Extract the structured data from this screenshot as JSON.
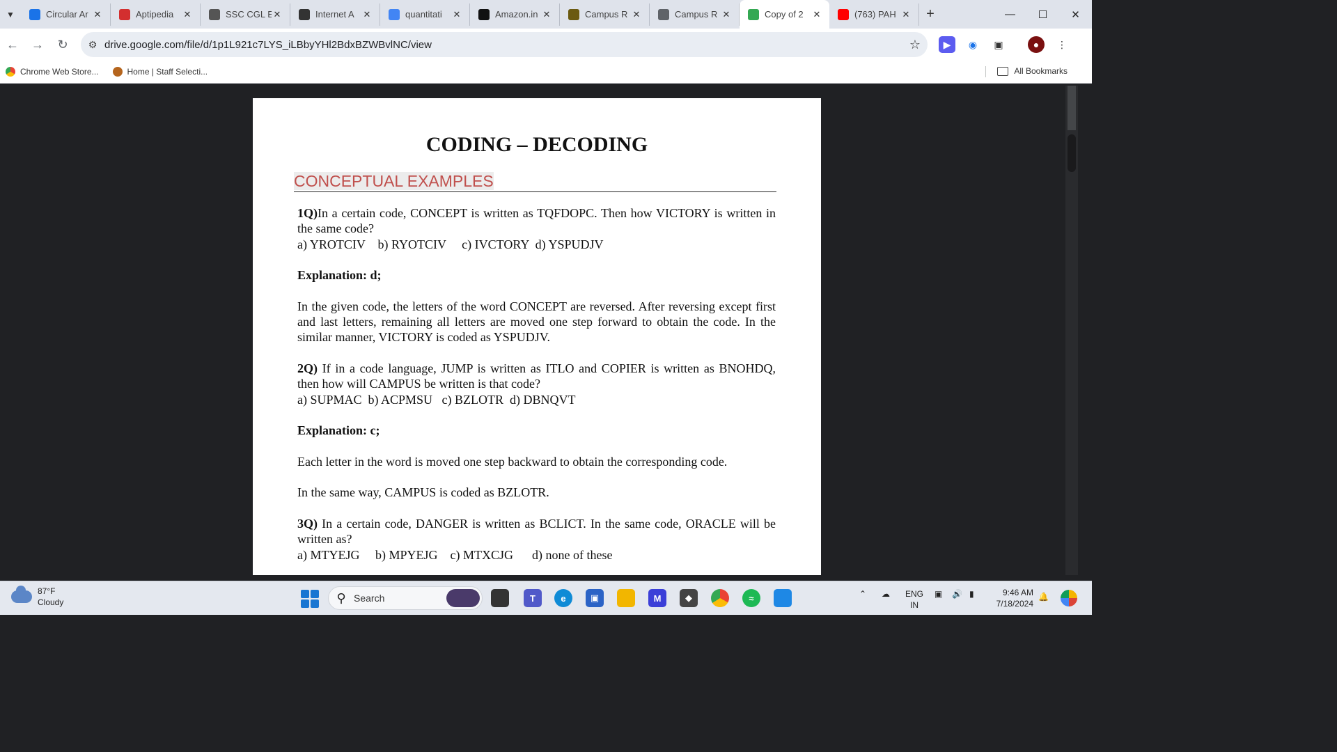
{
  "tabs": [
    {
      "label": "Circular Ar",
      "icon": "bookmark-icon",
      "color": "#1a73e8"
    },
    {
      "label": "Aptipedia",
      "icon": "aptipedia-logo-icon",
      "color": "#d32f2f"
    },
    {
      "label": "SSC CGL E",
      "icon": "chatgpt-icon",
      "color": "#555555"
    },
    {
      "label": "Internet A",
      "icon": "archive-icon",
      "color": "#333333"
    },
    {
      "label": "quantitati",
      "icon": "google-icon",
      "color": "#4285f4"
    },
    {
      "label": "Amazon.in",
      "icon": "amazon-icon",
      "color": "#111111"
    },
    {
      "label": "Campus R",
      "icon": "campus-icon",
      "color": "#6b5a10"
    },
    {
      "label": "Campus R",
      "icon": "globe-icon",
      "color": "#5f6368"
    },
    {
      "label": "Copy of 2",
      "icon": "google-drive-icon",
      "color": "#34a853",
      "active": true
    },
    {
      "label": "(763) PAH",
      "icon": "youtube-icon",
      "color": "#ff0000"
    }
  ],
  "toolbar": {
    "url": "drive.google.com/file/d/1p1L921c7LYS_iLBbyYHl2BdxBZWBvlNC/view"
  },
  "bookmarks": {
    "items": [
      {
        "label": "Chrome Web Store...",
        "icon": "chrome-web-store-icon"
      },
      {
        "label": "Home | Staff Selecti...",
        "icon": "ssc-emblem-icon"
      }
    ],
    "all_label": "All Bookmarks"
  },
  "document": {
    "title": "CODING – DECODING",
    "section": "CONCEPTUAL EXAMPLES",
    "q1": {
      "num": "1Q)",
      "text": "In a certain code, CONCEPT is written as TQFDOPC. Then how VICTORY is written in the same code?",
      "options": "a) YROTCIV    b) RYOTCIV     c) IVCTORY  d) YSPUDJV",
      "expl_label": "Explanation: d;",
      "expl": "In the given code, the letters of the word CONCEPT are reversed. After reversing except first and last letters, remaining all letters are moved one step forward to obtain the code. In the similar manner, VICTORY is coded as YSPUDJV."
    },
    "q2": {
      "num": "2Q)",
      "text": " If in a code language, JUMP is written as ITLO and COPIER is written as BNOHDQ, then how will CAMPUS be written is that code?",
      "options": "a) SUPMAC  b) ACPMSU   c) BZLOTR  d) DBNQVT",
      "expl_label": "Explanation: c;",
      "expl": "Each letter in the word is moved one step backward to obtain the corresponding code.",
      "expl2": "In the same way, CAMPUS is coded as BZLOTR."
    },
    "q3": {
      "num": "3Q)",
      "text": " In a certain code, DANGER  is written as BCLICT. In the same code, ORACLE will be written as?",
      "options": "a) MTYEJG     b) MPYEJG    c) MTXCJG      d) none of these"
    }
  },
  "taskbar": {
    "temp": "87°F",
    "condition": "Cloudy",
    "search_placeholder": "Search",
    "lang1": "ENG",
    "lang2": "IN",
    "time": "9:46 AM",
    "date": "7/18/2024"
  }
}
